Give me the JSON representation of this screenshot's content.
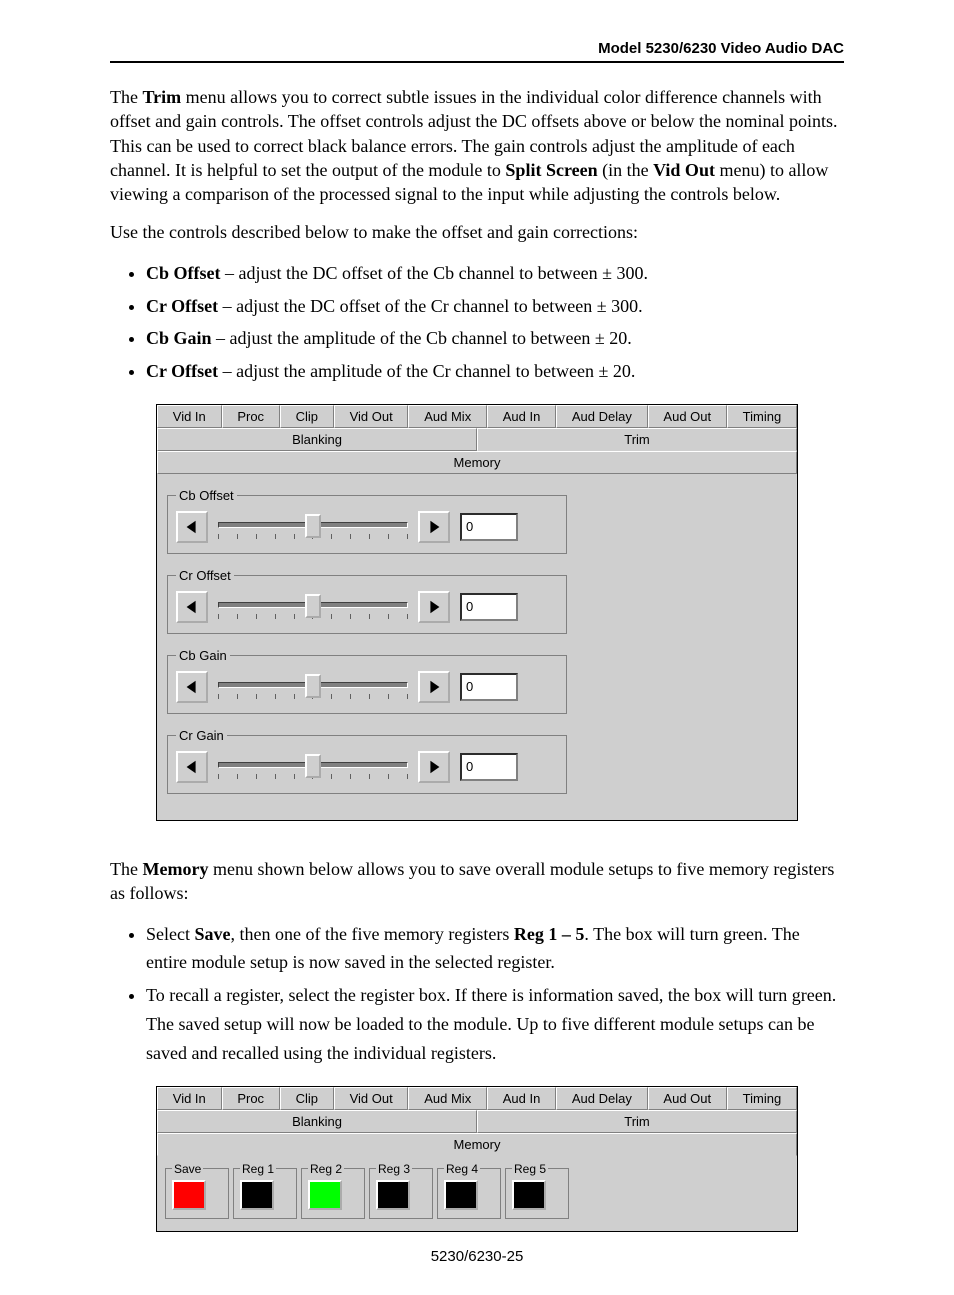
{
  "header": {
    "title": "Model 5230/6230 Video Audio DAC"
  },
  "footer": {
    "pageref": "5230/6230-25"
  },
  "text": {
    "trim_intro_pre": "The ",
    "trim_intro_b1": "Trim",
    "trim_intro_mid1": " menu allows you to correct subtle issues in the individual color difference channels with offset and gain controls. The offset controls adjust the DC offsets above or below the nominal points. This can be used to correct black balance errors. The gain controls adjust the amplitude of each channel. It is helpful to set the output of the module to ",
    "trim_intro_b2": "Split Screen",
    "trim_intro_mid2": " (in the ",
    "trim_intro_b3": "Vid Out",
    "trim_intro_tail": " menu) to allow viewing a comparison of the processed signal to the input while adjusting the controls below.",
    "trim_use": "Use the controls described below to make the offset and gain corrections:",
    "li1_b": "Cb Offset",
    "li1_t": " – adjust the DC offset of the Cb channel to between ± 300.",
    "li2_b": "Cr Offset",
    "li2_t": " –  adjust the DC offset of the Cr channel to between ± 300.",
    "li3_b": "Cb Gain",
    "li3_t": " –  adjust the amplitude of  the Cb channel to between ± 20.",
    "li4_b": "Cr Offset",
    "li4_t": " – adjust the amplitude of  the Cr channel to between ± 20.",
    "mem_intro_pre": "The ",
    "mem_intro_b": "Memory",
    "mem_intro_tail": " menu shown below allows you to save overall module setups to five memory registers as follows:",
    "mli1_pre": "Select ",
    "mli1_b1": "Save",
    "mli1_mid": ", then one of the five memory registers ",
    "mli1_b2": "Reg 1 – 5",
    "mli1_tail": ". The box will turn green. The entire module setup is now saved in the selected register.",
    "mli2": "To recall a register, select the register box. If there is information saved, the box will turn green. The saved setup will now be loaded to the module. Up to five different module setups can be saved and recalled using the individual registers."
  },
  "tabs": {
    "row1": [
      "Vid In",
      "Proc",
      "Clip",
      "Vid Out",
      "Aud Mix",
      "Aud In",
      "Aud Delay",
      "Aud Out",
      "Timing"
    ],
    "row2": [
      "Blanking",
      "Trim",
      "Memory"
    ]
  },
  "trim_panel": {
    "active_tab_row2": "Trim",
    "groups": [
      {
        "name": "Cb Offset",
        "value": "0"
      },
      {
        "name": "Cr Offset",
        "value": "0"
      },
      {
        "name": "Cb Gain",
        "value": "0"
      },
      {
        "name": "Cr Gain",
        "value": "0"
      }
    ]
  },
  "mem_panel": {
    "active_tab_row2": "Memory",
    "regs": [
      {
        "label": "Save",
        "color": "red"
      },
      {
        "label": "Reg 1",
        "color": "black"
      },
      {
        "label": "Reg 2",
        "color": "green"
      },
      {
        "label": "Reg 3",
        "color": "black"
      },
      {
        "label": "Reg 4",
        "color": "black"
      },
      {
        "label": "Reg 5",
        "color": "black"
      }
    ]
  }
}
